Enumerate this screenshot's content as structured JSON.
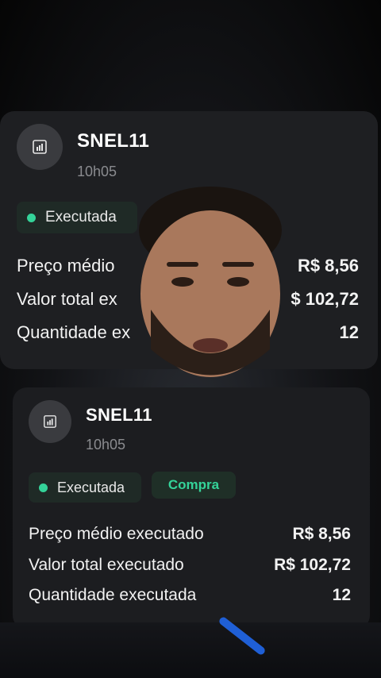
{
  "orders": [
    {
      "ticker": "SNEL11",
      "time": "10h05",
      "status": "Executada",
      "rows": [
        {
          "label": "Preço médio",
          "value": "R$ 8,56"
        },
        {
          "label": "Valor total ex",
          "value": "$ 102,72"
        },
        {
          "label": "Quantidade ex",
          "value": "12"
        }
      ]
    },
    {
      "ticker": "SNEL11",
      "time": "10h05",
      "status": "Executada",
      "side": "Compra",
      "rows": [
        {
          "label": "Preço médio executado",
          "value": "R$ 8,56"
        },
        {
          "label": "Valor total executado",
          "value": "R$ 102,72"
        },
        {
          "label": "Quantidade executada",
          "value": "12"
        }
      ]
    }
  ],
  "colors": {
    "card_bg": "#1e1f22",
    "status_dot": "#34d399",
    "buy_text": "#34d399",
    "muted_text": "#8a8b8f"
  }
}
